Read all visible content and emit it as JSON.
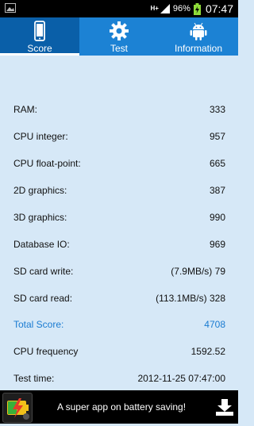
{
  "status_bar": {
    "network": "H+",
    "battery_percent": "96%",
    "time": "07:47"
  },
  "tabs": [
    {
      "label": "Score",
      "icon": "phone-icon",
      "active": true
    },
    {
      "label": "Test",
      "icon": "gear-icon",
      "active": false
    },
    {
      "label": "Information",
      "icon": "android-icon",
      "active": false
    }
  ],
  "results": [
    {
      "label": "RAM:",
      "value": "333"
    },
    {
      "label": "CPU integer:",
      "value": "957"
    },
    {
      "label": "CPU float-point:",
      "value": "665"
    },
    {
      "label": "2D graphics:",
      "value": "387"
    },
    {
      "label": "3D graphics:",
      "value": "990"
    },
    {
      "label": "Database IO:",
      "value": "969"
    },
    {
      "label": "SD card write:",
      "value": "(7.9MB/s) 79"
    },
    {
      "label": "SD card read:",
      "value": "(113.1MB/s) 328"
    },
    {
      "label": "Total Score:",
      "value": "4708"
    },
    {
      "label": "CPU frequency",
      "value": "1592.52"
    },
    {
      "label": "Test time:",
      "value": "2012-11-25 07:47:00"
    }
  ],
  "ad": {
    "text": "A super app on battery saving!"
  },
  "colors": {
    "tab_bar": "#1c82d4",
    "tab_active": "#0a5fa8",
    "background": "#d6e8f7",
    "total_score": "#1a7bd1"
  }
}
